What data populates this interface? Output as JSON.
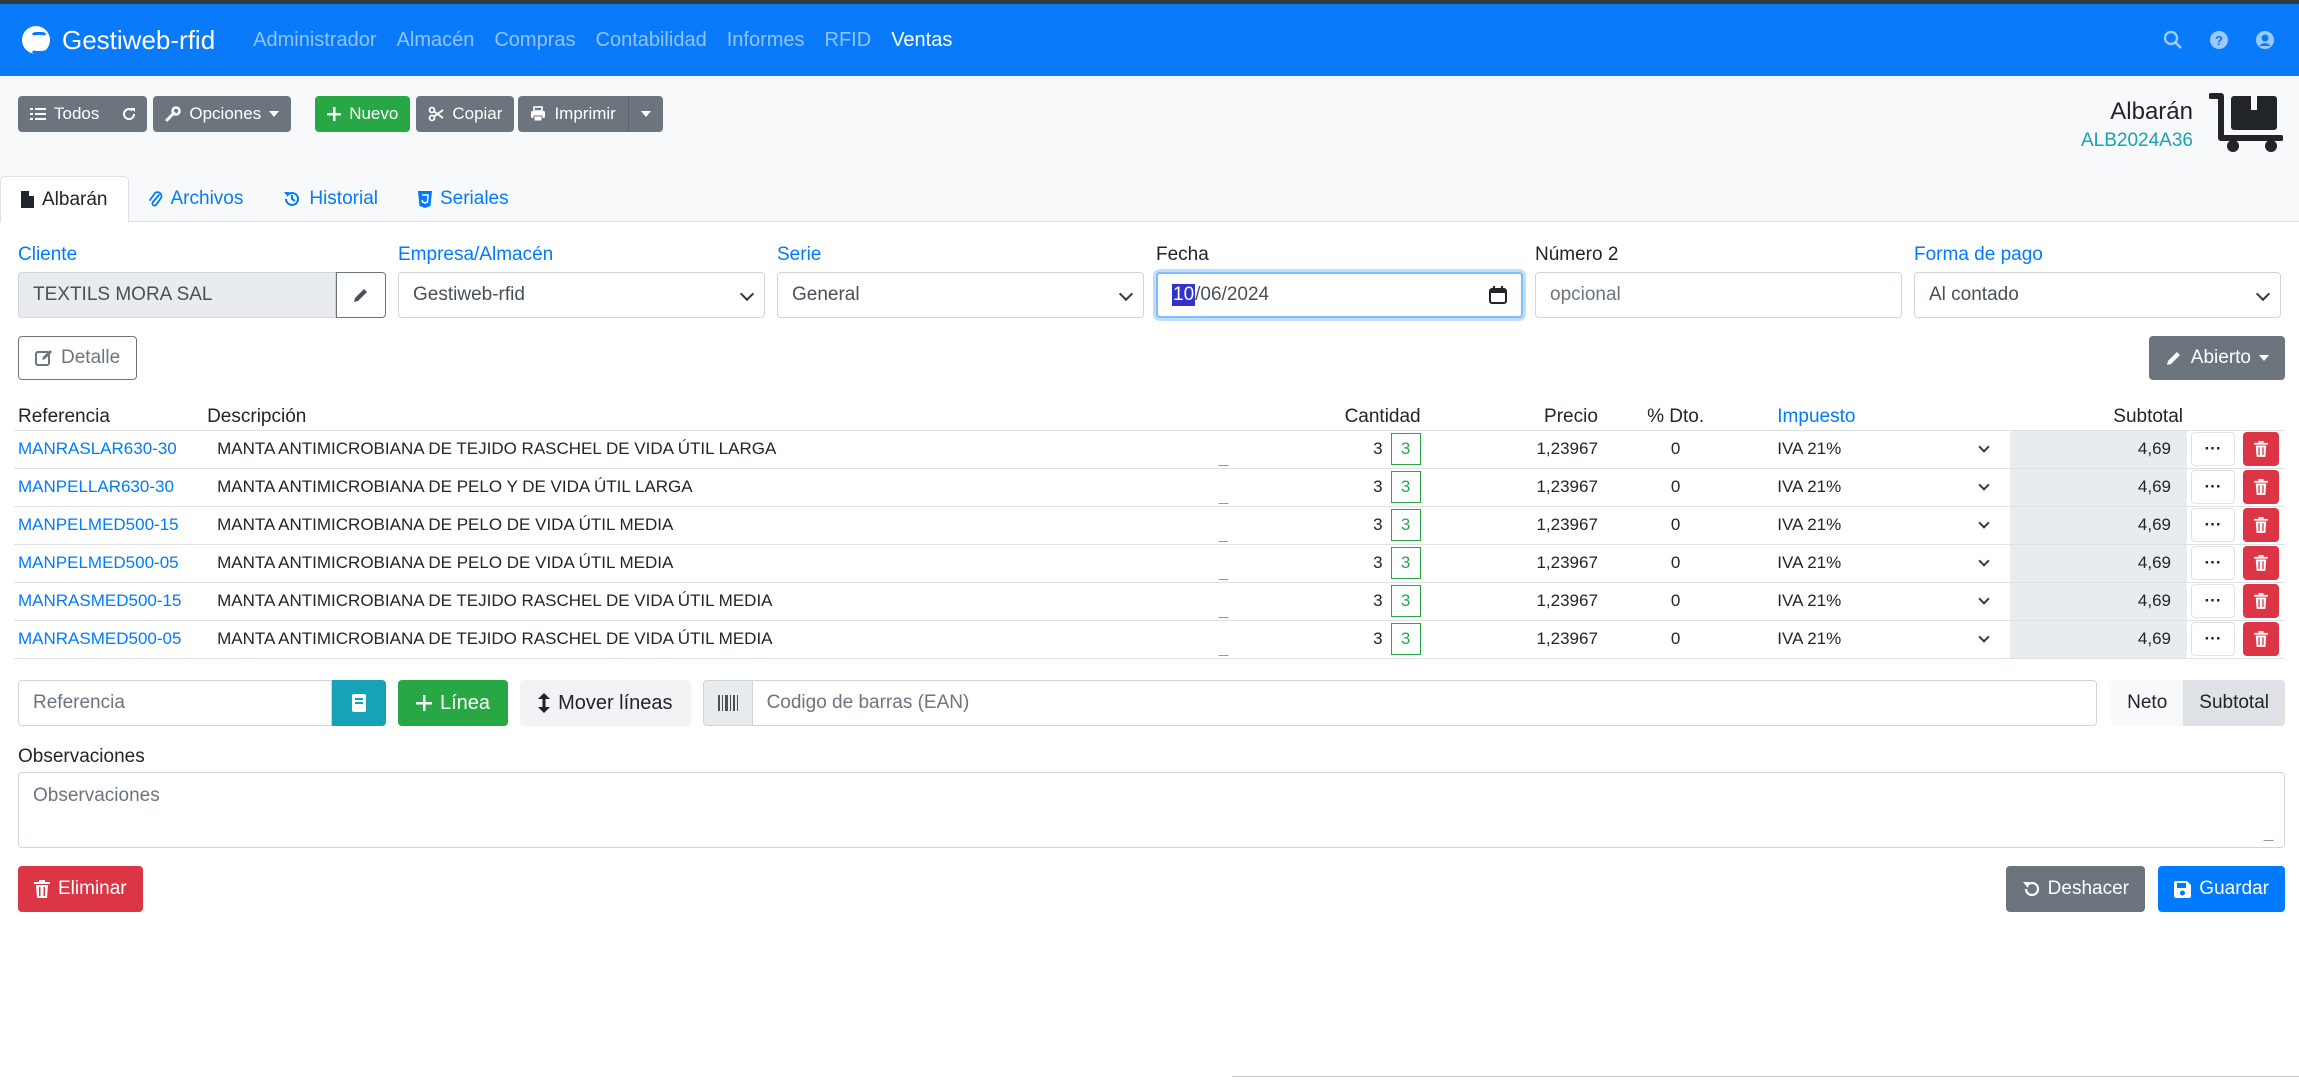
{
  "app": {
    "title": "Gestiweb-rfid"
  },
  "nav": {
    "items": [
      "Administrador",
      "Almacén",
      "Compras",
      "Contabilidad",
      "Informes",
      "RFID",
      "Ventas"
    ],
    "active": "Ventas"
  },
  "toolbar": {
    "all_label": "Todos",
    "options_label": "Opciones",
    "new_label": "Nuevo",
    "copy_label": "Copiar",
    "print_label": "Imprimir"
  },
  "document": {
    "type": "Albarán",
    "code": "ALB2024A36"
  },
  "tabs": [
    {
      "label": "Albarán",
      "icon": "file-icon",
      "active": true
    },
    {
      "label": "Archivos",
      "icon": "paperclip-icon"
    },
    {
      "label": "Historial",
      "icon": "history-icon"
    },
    {
      "label": "Seriales",
      "icon": "html5-icon"
    }
  ],
  "form": {
    "cliente": {
      "label": "Cliente",
      "value": "TEXTILS MORA SAL"
    },
    "empresa": {
      "label": "Empresa/Almacén",
      "value": "Gestiweb-rfid"
    },
    "serie": {
      "label": "Serie",
      "value": "General"
    },
    "fecha": {
      "label": "Fecha",
      "day": "10",
      "rest": "/06/2024"
    },
    "numero2": {
      "label": "Número 2",
      "placeholder": "opcional"
    },
    "forma_pago": {
      "label": "Forma de pago",
      "value": "Al contado"
    }
  },
  "detail_label": "Detalle",
  "status_label": "Abierto",
  "table": {
    "headers": {
      "ref": "Referencia",
      "desc": "Descripción",
      "qty": "Cantidad",
      "price": "Precio",
      "dto": "% Dto.",
      "tax": "Impuesto",
      "subtotal": "Subtotal"
    },
    "rows": [
      {
        "ref": "MANRASLAR630-30",
        "desc": "MANTA ANTIMICROBIANA DE TEJIDO RASCHEL DE VIDA ÚTIL LARGA",
        "qty": "3",
        "served": "3",
        "price": "1,23967",
        "dto": "0",
        "tax": "IVA 21%",
        "subtotal": "4,69"
      },
      {
        "ref": "MANPELLAR630-30",
        "desc": "MANTA ANTIMICROBIANA DE PELO Y DE VIDA ÚTIL LARGA",
        "qty": "3",
        "served": "3",
        "price": "1,23967",
        "dto": "0",
        "tax": "IVA 21%",
        "subtotal": "4,69"
      },
      {
        "ref": "MANPELMED500-15",
        "desc": "MANTA ANTIMICROBIANA DE PELO DE VIDA ÚTIL MEDIA",
        "qty": "3",
        "served": "3",
        "price": "1,23967",
        "dto": "0",
        "tax": "IVA 21%",
        "subtotal": "4,69"
      },
      {
        "ref": "MANPELMED500-05",
        "desc": "MANTA ANTIMICROBIANA DE PELO DE VIDA ÚTIL MEDIA",
        "qty": "3",
        "served": "3",
        "price": "1,23967",
        "dto": "0",
        "tax": "IVA 21%",
        "subtotal": "4,69"
      },
      {
        "ref": "MANRASMED500-15",
        "desc": "MANTA ANTIMICROBIANA DE TEJIDO RASCHEL DE VIDA ÚTIL MEDIA",
        "qty": "3",
        "served": "3",
        "price": "1,23967",
        "dto": "0",
        "tax": "IVA 21%",
        "subtotal": "4,69"
      },
      {
        "ref": "MANRASMED500-05",
        "desc": "MANTA ANTIMICROBIANA DE TEJIDO RASCHEL DE VIDA ÚTIL MEDIA",
        "qty": "3",
        "served": "3",
        "price": "1,23967",
        "dto": "0",
        "tax": "IVA 21%",
        "subtotal": "4,69"
      }
    ]
  },
  "add_line": {
    "ref_placeholder": "Referencia",
    "line_label": "Línea",
    "move_label": "Mover líneas",
    "barcode_placeholder": "Codigo de barras (EAN)",
    "neto_label": "Neto",
    "subtotal_label": "Subtotal"
  },
  "observaciones": {
    "label": "Observaciones",
    "placeholder": "Observaciones"
  },
  "footer": {
    "delete_label": "Eliminar",
    "undo_label": "Deshacer",
    "save_label": "Guardar"
  },
  "colors": {
    "navbar": "#097bfa",
    "primary": "#007bff",
    "success": "#28a745",
    "danger": "#dc3545",
    "secondary": "#6c757d",
    "info": "#17a2b8"
  }
}
